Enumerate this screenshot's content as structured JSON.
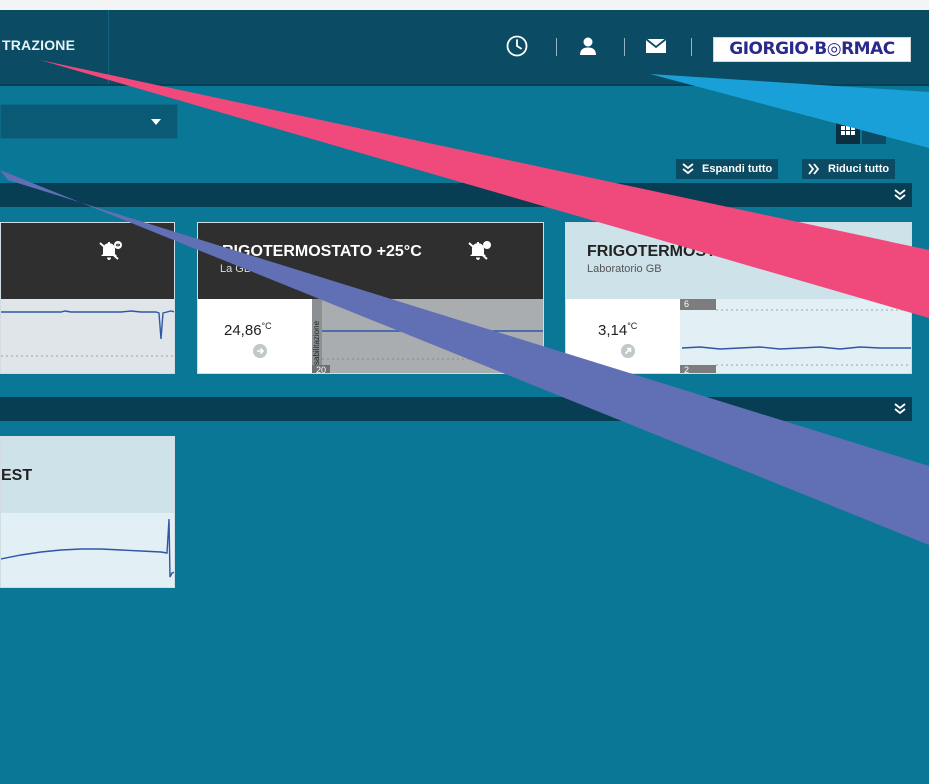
{
  "navbar": {
    "tab_label": "TRAZIONE",
    "logo_text": "GIORGIO·B◎RMAC"
  },
  "toolbar": {
    "expand_all": "Espandi tutto",
    "collapse_all": "Riduci tutto"
  },
  "cards": [
    {
      "title": "",
      "subtitle": "",
      "value": "",
      "unit": ""
    },
    {
      "title": "RIGOTERMOSTATO +25°C",
      "subtitle": "La    GB",
      "value": "24,86",
      "unit": "°C",
      "side_label": "sabilitazione",
      "tick_bottom": "20"
    },
    {
      "title": "FRIGOTERMOST",
      "subtitle": "Laboratorio GB",
      "value": "3,14",
      "unit": "°C",
      "tick_top": "6",
      "tick_bottom": "2"
    },
    {
      "title": "EST",
      "subtitle": ""
    }
  ],
  "colors": {
    "background": "#0a7797",
    "navbar": "#0b4b63",
    "group_bar": "#073e53",
    "card_dark_header": "#2f2f2f",
    "card_light_header": "#cde2e9",
    "series_line": "#2f56a8"
  }
}
